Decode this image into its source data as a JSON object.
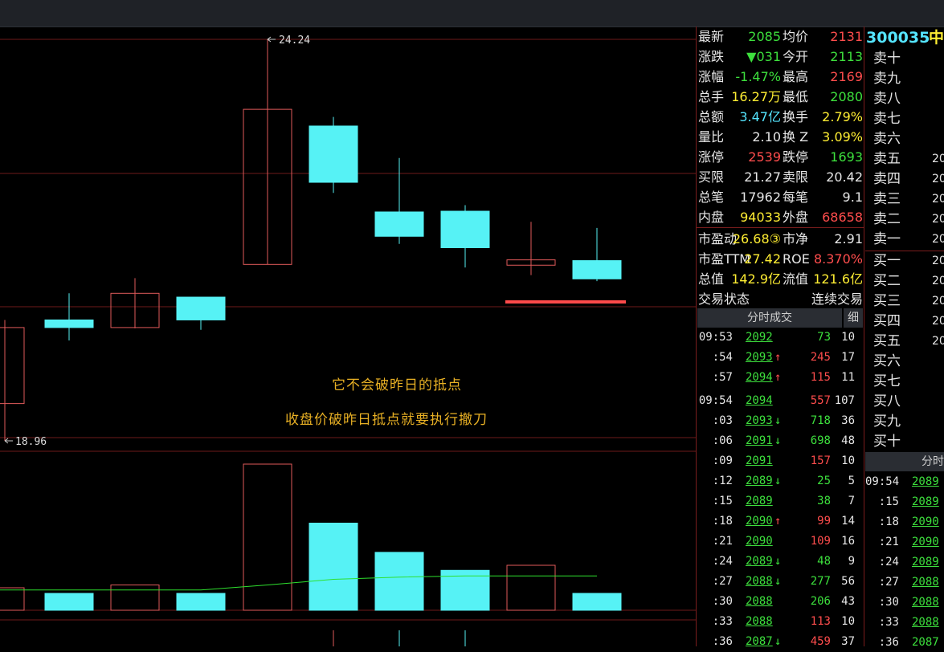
{
  "chart_data": [
    {
      "type": "candlestick",
      "high_label": "24.24",
      "low_label": "18.96",
      "candles": [
        {
          "open": 20.45,
          "close": 19.45,
          "high": 20.55,
          "low": 18.96,
          "bull": true
        },
        {
          "open": 20.55,
          "close": 20.45,
          "high": 20.9,
          "low": 20.28,
          "bull": false
        },
        {
          "open": 20.45,
          "close": 20.9,
          "high": 21.1,
          "low": 20.44,
          "bull": true
        },
        {
          "open": 20.85,
          "close": 20.55,
          "high": 20.85,
          "low": 20.42,
          "bull": false
        },
        {
          "open": 21.28,
          "close": 23.32,
          "high": 24.24,
          "low": 21.28,
          "bull": true
        },
        {
          "open": 23.1,
          "close": 22.36,
          "high": 23.22,
          "low": 22.22,
          "bull": false
        },
        {
          "open": 21.97,
          "close": 21.65,
          "high": 22.68,
          "low": 21.55,
          "bull": false
        },
        {
          "open": 21.98,
          "close": 21.5,
          "high": 22.06,
          "low": 21.24,
          "bull": false
        },
        {
          "open": 21.34,
          "close": 21.27,
          "high": 21.84,
          "low": 21.14,
          "bull": true
        },
        {
          "open": 21.33,
          "close": 21.09,
          "high": 21.76,
          "low": 21.06,
          "bull": false
        }
      ]
    },
    {
      "type": "bar",
      "series": [
        {
          "values": [
            4.0,
            3.0,
            4.5,
            3.0,
            26.0,
            15.5,
            10.3,
            7.1,
            8.0,
            3.0
          ]
        }
      ],
      "ma_line": [
        3.6,
        3.6,
        3.6,
        3.6,
        4.5,
        5.5,
        5.9,
        6.1,
        6.1,
        6.1
      ]
    }
  ],
  "annotations": {
    "line1": "它不会破昨日的抵点",
    "line2": "收盘价破昨日抵点就要执行撤刀"
  },
  "quote": {
    "rows": [
      {
        "l1": "最新",
        "v1": "2085",
        "c1": "grn",
        "l2": "均价",
        "v2": "2131",
        "c2": "red"
      },
      {
        "l1": "涨跌",
        "v1": "▼031",
        "c1": "grn",
        "l2": "今开",
        "v2": "2113",
        "c2": "grn"
      },
      {
        "l1": "涨幅",
        "v1": "-1.47%",
        "c1": "grn",
        "l2": "最高",
        "v2": "2169",
        "c2": "red"
      },
      {
        "l1": "总手",
        "v1": "16.27万",
        "c1": "yel",
        "l2": "最低",
        "v2": "2080",
        "c2": "grn"
      },
      {
        "l1": "总额",
        "v1": "3.47亿",
        "c1": "cyan",
        "l2": "换手",
        "v2": "2.79%",
        "c2": "yel"
      },
      {
        "l1": "量比",
        "v1": "2.10",
        "c1": "wht",
        "l2": "换 Z",
        "v2": "3.09%",
        "c2": "yel"
      },
      {
        "l1": "涨停",
        "v1": "2539",
        "c1": "red",
        "l2": "跌停",
        "v2": "1693",
        "c2": "grn"
      },
      {
        "l1": "买限",
        "v1": "21.27",
        "c1": "wht",
        "l2": "卖限",
        "v2": "20.42",
        "c2": "wht"
      },
      {
        "l1": "总笔",
        "v1": "17962",
        "c1": "wht",
        "l2": "每笔",
        "v2": "9.1",
        "c2": "wht"
      },
      {
        "l1": "内盘",
        "v1": "94033",
        "c1": "yel",
        "l2": "外盘",
        "v2": "68658",
        "c2": "red"
      },
      {
        "l1": "市盈动",
        "v1": "26.68③",
        "c1": "yel",
        "l2": "市净",
        "v2": "2.91",
        "c2": "wht"
      },
      {
        "l1": "市盈TTM",
        "v1": "27.42",
        "c1": "yel",
        "l2": "ROE",
        "v2": "8.370%",
        "c2": "red"
      },
      {
        "l1": "总值",
        "v1": "142.9亿",
        "c1": "yel",
        "l2": "流值",
        "v2": "121.6亿",
        "c2": "yel"
      },
      {
        "l1": "交易状态",
        "v1": "",
        "c1": "wht",
        "l2": "",
        "v2": "连续交易",
        "c2": "wht"
      }
    ]
  },
  "ticks": {
    "header": "分时成交",
    "detail": "细",
    "rows": [
      {
        "t": "09:53",
        "p": "2092",
        "a": "",
        "v": "73",
        "vc": "grn",
        "n": "10"
      },
      {
        "t": ":54",
        "p": "2093",
        "a": "↑",
        "v": "245",
        "vc": "red",
        "n": "17"
      },
      {
        "t": ":57",
        "p": "2094",
        "a": "↑",
        "v": "115",
        "vc": "red",
        "n": "11"
      },
      {
        "t": "09:54",
        "p": "2094",
        "a": "",
        "v": "557",
        "vc": "red",
        "n": "107"
      },
      {
        "t": ":03",
        "p": "2093",
        "a": "↓",
        "v": "718",
        "vc": "grn",
        "n": "36"
      },
      {
        "t": ":06",
        "p": "2091",
        "a": "↓",
        "v": "698",
        "vc": "grn",
        "n": "48"
      },
      {
        "t": ":09",
        "p": "2091",
        "a": "",
        "v": "157",
        "vc": "red",
        "n": "10"
      },
      {
        "t": ":12",
        "p": "2089",
        "a": "↓",
        "v": "25",
        "vc": "grn",
        "n": "5"
      },
      {
        "t": ":15",
        "p": "2089",
        "a": "",
        "v": "38",
        "vc": "grn",
        "n": "7"
      },
      {
        "t": ":18",
        "p": "2090",
        "a": "↑",
        "v": "99",
        "vc": "red",
        "n": "14"
      },
      {
        "t": ":21",
        "p": "2090",
        "a": "",
        "v": "109",
        "vc": "red",
        "n": "16"
      },
      {
        "t": ":24",
        "p": "2089",
        "a": "↓",
        "v": "48",
        "vc": "grn",
        "n": "9"
      },
      {
        "t": ":27",
        "p": "2088",
        "a": "↓",
        "v": "277",
        "vc": "grn",
        "n": "56"
      },
      {
        "t": ":30",
        "p": "2088",
        "a": "",
        "v": "206",
        "vc": "grn",
        "n": "43"
      },
      {
        "t": ":33",
        "p": "2088",
        "a": "",
        "v": "113",
        "vc": "red",
        "n": "10"
      },
      {
        "t": ":36",
        "p": "2087",
        "a": "↓",
        "v": "459",
        "vc": "red",
        "n": "37"
      }
    ]
  },
  "book": {
    "code": "300035",
    "name_cut": "中",
    "sells": [
      "卖十",
      "卖九",
      "卖八",
      "卖七",
      "卖六",
      "卖五",
      "卖四",
      "卖三",
      "卖二",
      "卖一"
    ],
    "buys": [
      "买一",
      "买二",
      "买三",
      "买四",
      "买五",
      "买六",
      "买七",
      "买八",
      "买九",
      "买十"
    ],
    "sell_prices": [
      "",
      "",
      "",
      "",
      "",
      "20",
      "20",
      "20",
      "20",
      "20"
    ],
    "buy_prices": [
      "20",
      "20",
      "20",
      "20",
      "20",
      "",
      "",
      "",
      "",
      ""
    ],
    "header": "分时",
    "ticks": [
      {
        "t": "09:54",
        "p": "2089"
      },
      {
        "t": ":15",
        "p": "2089"
      },
      {
        "t": ":18",
        "p": "2090"
      },
      {
        "t": ":21",
        "p": "2090"
      },
      {
        "t": ":24",
        "p": "2089"
      },
      {
        "t": ":27",
        "p": "2088"
      },
      {
        "t": ":30",
        "p": "2088"
      },
      {
        "t": ":33",
        "p": "2088"
      },
      {
        "t": ":36",
        "p": "2087"
      }
    ]
  }
}
